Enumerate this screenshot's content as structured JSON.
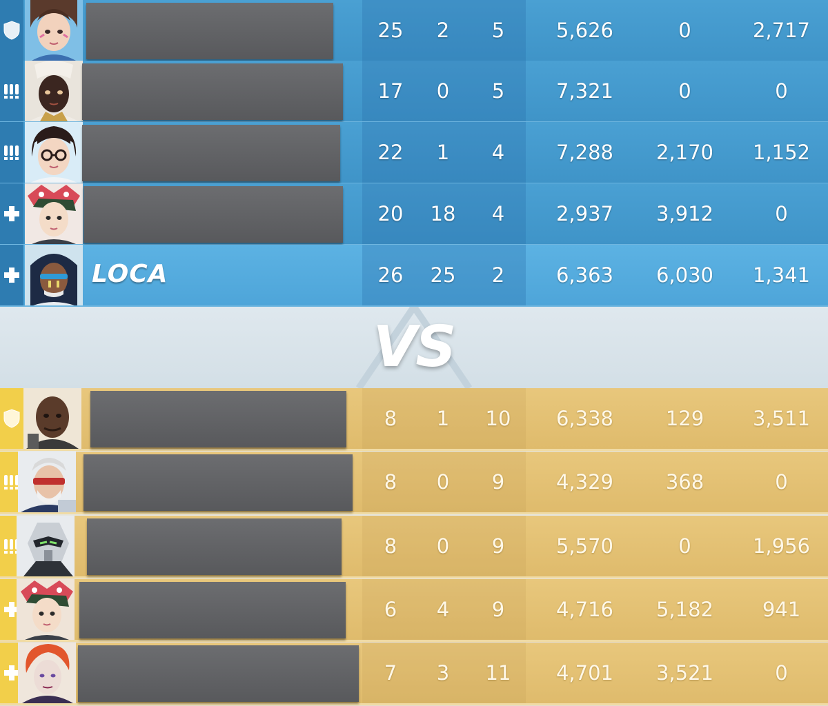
{
  "team_blue": {
    "accent_color": "#4aa0d3",
    "players": [
      {
        "role_icon": "tank-shield-icon",
        "name": "",
        "eliminations": "25",
        "assists": "2",
        "deaths": "5",
        "damage": "5,626",
        "healing": "0",
        "mitigated": "2,717"
      },
      {
        "role_icon": "damage-icon",
        "name": "",
        "eliminations": "17",
        "assists": "0",
        "deaths": "5",
        "damage": "7,321",
        "healing": "0",
        "mitigated": "0"
      },
      {
        "role_icon": "damage-icon",
        "name": "",
        "eliminations": "22",
        "assists": "1",
        "deaths": "4",
        "damage": "7,288",
        "healing": "2,170",
        "mitigated": "1,152"
      },
      {
        "role_icon": "support-cross-icon",
        "name": "",
        "eliminations": "20",
        "assists": "18",
        "deaths": "4",
        "damage": "2,937",
        "healing": "3,912",
        "mitigated": "0"
      },
      {
        "role_icon": "support-cross-icon",
        "name": "LOCA",
        "eliminations": "26",
        "assists": "25",
        "deaths": "2",
        "damage": "6,363",
        "healing": "6,030",
        "mitigated": "1,341"
      }
    ]
  },
  "versus": {
    "label": "VS"
  },
  "team_yellow": {
    "accent_color": "#e8c77c",
    "players": [
      {
        "role_icon": "tank-shield-icon",
        "name": "",
        "eliminations": "8",
        "assists": "1",
        "deaths": "10",
        "damage": "6,338",
        "healing": "129",
        "mitigated": "3,511"
      },
      {
        "role_icon": "damage-icon",
        "name": "",
        "eliminations": "8",
        "assists": "0",
        "deaths": "9",
        "damage": "4,329",
        "healing": "368",
        "mitigated": "0"
      },
      {
        "role_icon": "damage-icon",
        "name": "",
        "eliminations": "8",
        "assists": "0",
        "deaths": "9",
        "damage": "5,570",
        "healing": "0",
        "mitigated": "1,956"
      },
      {
        "role_icon": "support-cross-icon",
        "name": "",
        "eliminations": "6",
        "assists": "4",
        "deaths": "9",
        "damage": "4,716",
        "healing": "5,182",
        "mitigated": "941"
      },
      {
        "role_icon": "support-cross-icon",
        "name": "",
        "eliminations": "7",
        "assists": "3",
        "deaths": "11",
        "damage": "4,701",
        "healing": "3,521",
        "mitigated": "0"
      }
    ]
  }
}
